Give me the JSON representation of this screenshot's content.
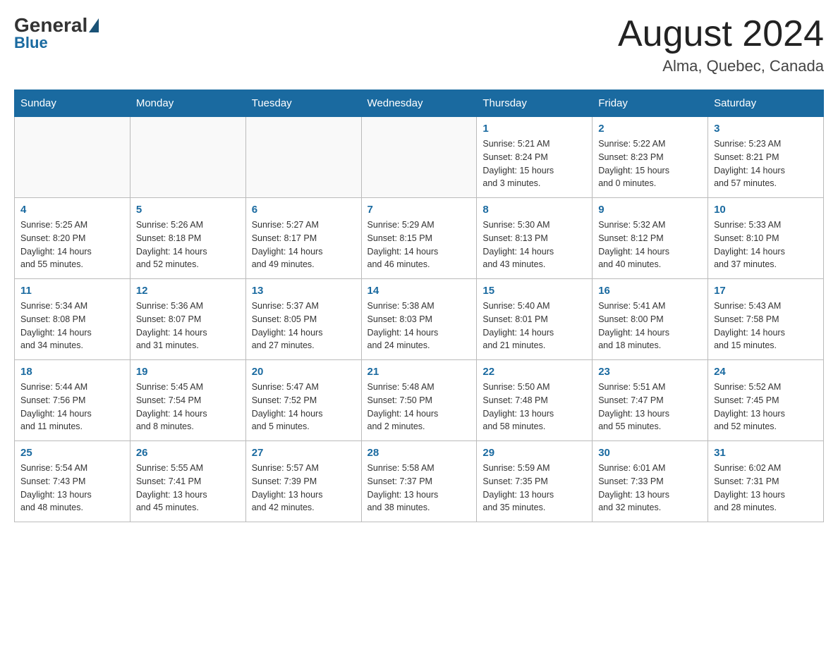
{
  "header": {
    "logo_general": "General",
    "logo_blue": "Blue",
    "month_year": "August 2024",
    "location": "Alma, Quebec, Canada"
  },
  "days_of_week": [
    "Sunday",
    "Monday",
    "Tuesday",
    "Wednesday",
    "Thursday",
    "Friday",
    "Saturday"
  ],
  "weeks": [
    [
      {
        "day": "",
        "info": ""
      },
      {
        "day": "",
        "info": ""
      },
      {
        "day": "",
        "info": ""
      },
      {
        "day": "",
        "info": ""
      },
      {
        "day": "1",
        "info": "Sunrise: 5:21 AM\nSunset: 8:24 PM\nDaylight: 15 hours\nand 3 minutes."
      },
      {
        "day": "2",
        "info": "Sunrise: 5:22 AM\nSunset: 8:23 PM\nDaylight: 15 hours\nand 0 minutes."
      },
      {
        "day": "3",
        "info": "Sunrise: 5:23 AM\nSunset: 8:21 PM\nDaylight: 14 hours\nand 57 minutes."
      }
    ],
    [
      {
        "day": "4",
        "info": "Sunrise: 5:25 AM\nSunset: 8:20 PM\nDaylight: 14 hours\nand 55 minutes."
      },
      {
        "day": "5",
        "info": "Sunrise: 5:26 AM\nSunset: 8:18 PM\nDaylight: 14 hours\nand 52 minutes."
      },
      {
        "day": "6",
        "info": "Sunrise: 5:27 AM\nSunset: 8:17 PM\nDaylight: 14 hours\nand 49 minutes."
      },
      {
        "day": "7",
        "info": "Sunrise: 5:29 AM\nSunset: 8:15 PM\nDaylight: 14 hours\nand 46 minutes."
      },
      {
        "day": "8",
        "info": "Sunrise: 5:30 AM\nSunset: 8:13 PM\nDaylight: 14 hours\nand 43 minutes."
      },
      {
        "day": "9",
        "info": "Sunrise: 5:32 AM\nSunset: 8:12 PM\nDaylight: 14 hours\nand 40 minutes."
      },
      {
        "day": "10",
        "info": "Sunrise: 5:33 AM\nSunset: 8:10 PM\nDaylight: 14 hours\nand 37 minutes."
      }
    ],
    [
      {
        "day": "11",
        "info": "Sunrise: 5:34 AM\nSunset: 8:08 PM\nDaylight: 14 hours\nand 34 minutes."
      },
      {
        "day": "12",
        "info": "Sunrise: 5:36 AM\nSunset: 8:07 PM\nDaylight: 14 hours\nand 31 minutes."
      },
      {
        "day": "13",
        "info": "Sunrise: 5:37 AM\nSunset: 8:05 PM\nDaylight: 14 hours\nand 27 minutes."
      },
      {
        "day": "14",
        "info": "Sunrise: 5:38 AM\nSunset: 8:03 PM\nDaylight: 14 hours\nand 24 minutes."
      },
      {
        "day": "15",
        "info": "Sunrise: 5:40 AM\nSunset: 8:01 PM\nDaylight: 14 hours\nand 21 minutes."
      },
      {
        "day": "16",
        "info": "Sunrise: 5:41 AM\nSunset: 8:00 PM\nDaylight: 14 hours\nand 18 minutes."
      },
      {
        "day": "17",
        "info": "Sunrise: 5:43 AM\nSunset: 7:58 PM\nDaylight: 14 hours\nand 15 minutes."
      }
    ],
    [
      {
        "day": "18",
        "info": "Sunrise: 5:44 AM\nSunset: 7:56 PM\nDaylight: 14 hours\nand 11 minutes."
      },
      {
        "day": "19",
        "info": "Sunrise: 5:45 AM\nSunset: 7:54 PM\nDaylight: 14 hours\nand 8 minutes."
      },
      {
        "day": "20",
        "info": "Sunrise: 5:47 AM\nSunset: 7:52 PM\nDaylight: 14 hours\nand 5 minutes."
      },
      {
        "day": "21",
        "info": "Sunrise: 5:48 AM\nSunset: 7:50 PM\nDaylight: 14 hours\nand 2 minutes."
      },
      {
        "day": "22",
        "info": "Sunrise: 5:50 AM\nSunset: 7:48 PM\nDaylight: 13 hours\nand 58 minutes."
      },
      {
        "day": "23",
        "info": "Sunrise: 5:51 AM\nSunset: 7:47 PM\nDaylight: 13 hours\nand 55 minutes."
      },
      {
        "day": "24",
        "info": "Sunrise: 5:52 AM\nSunset: 7:45 PM\nDaylight: 13 hours\nand 52 minutes."
      }
    ],
    [
      {
        "day": "25",
        "info": "Sunrise: 5:54 AM\nSunset: 7:43 PM\nDaylight: 13 hours\nand 48 minutes."
      },
      {
        "day": "26",
        "info": "Sunrise: 5:55 AM\nSunset: 7:41 PM\nDaylight: 13 hours\nand 45 minutes."
      },
      {
        "day": "27",
        "info": "Sunrise: 5:57 AM\nSunset: 7:39 PM\nDaylight: 13 hours\nand 42 minutes."
      },
      {
        "day": "28",
        "info": "Sunrise: 5:58 AM\nSunset: 7:37 PM\nDaylight: 13 hours\nand 38 minutes."
      },
      {
        "day": "29",
        "info": "Sunrise: 5:59 AM\nSunset: 7:35 PM\nDaylight: 13 hours\nand 35 minutes."
      },
      {
        "day": "30",
        "info": "Sunrise: 6:01 AM\nSunset: 7:33 PM\nDaylight: 13 hours\nand 32 minutes."
      },
      {
        "day": "31",
        "info": "Sunrise: 6:02 AM\nSunset: 7:31 PM\nDaylight: 13 hours\nand 28 minutes."
      }
    ]
  ]
}
